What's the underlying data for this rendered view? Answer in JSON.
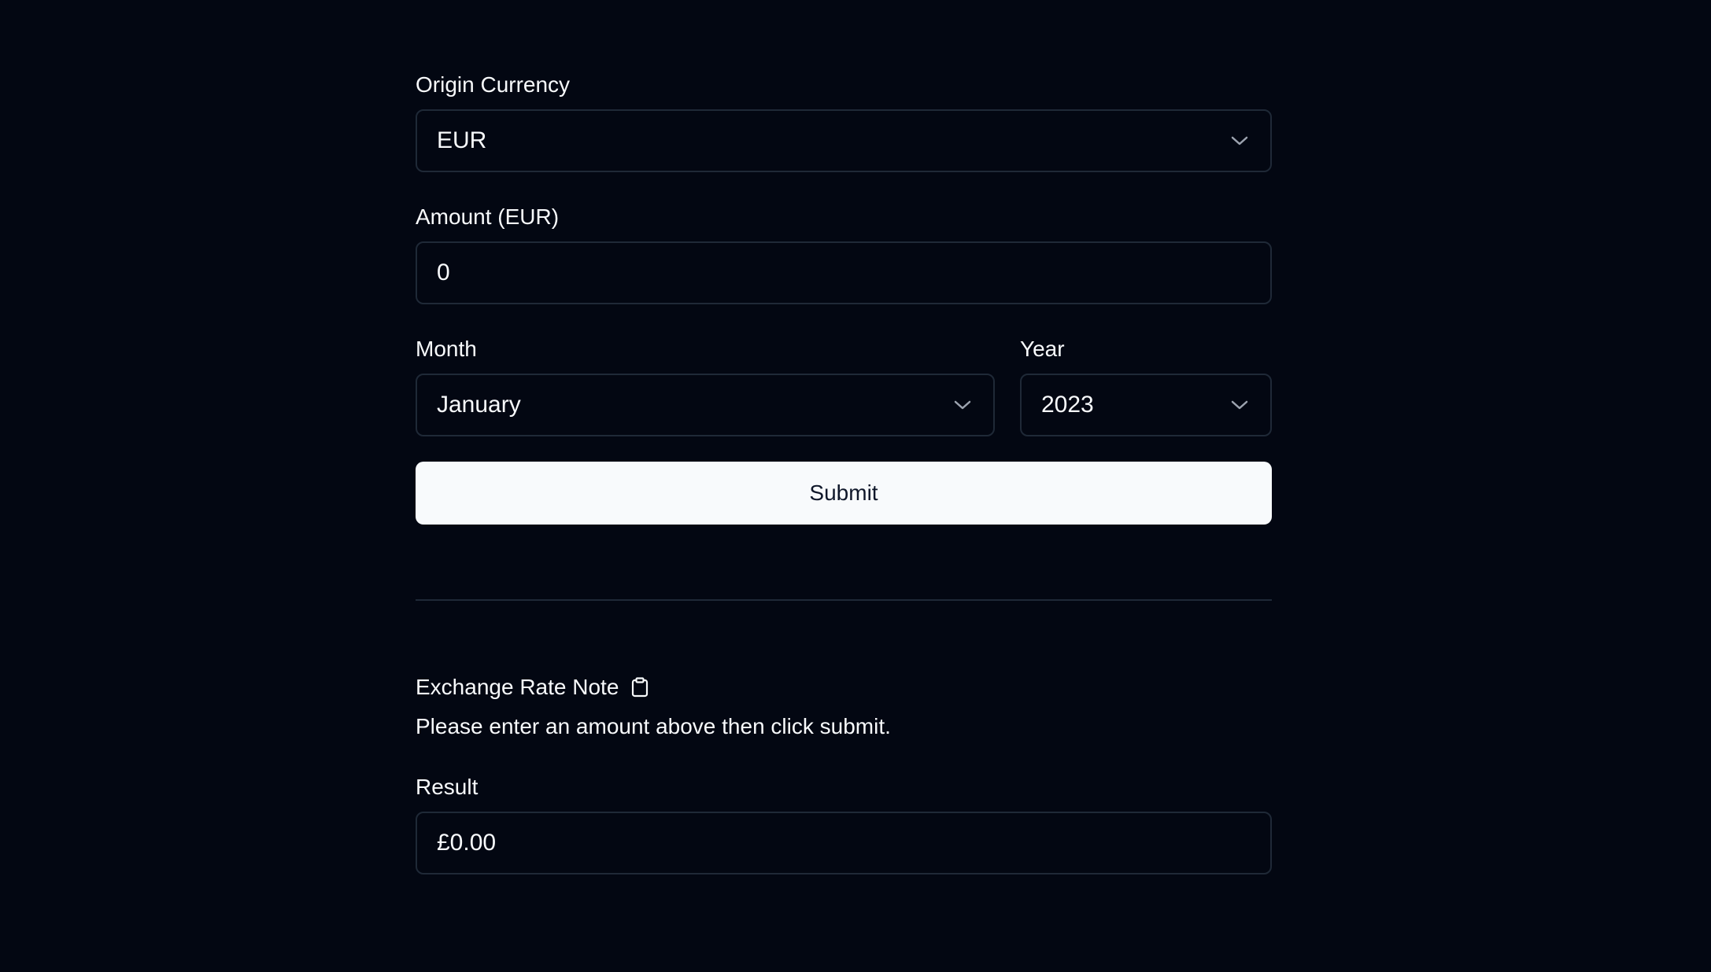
{
  "origin_currency": {
    "label": "Origin Currency",
    "selected": "EUR"
  },
  "amount": {
    "label": "Amount (EUR)",
    "value": "0"
  },
  "month": {
    "label": "Month",
    "selected": "January"
  },
  "year": {
    "label": "Year",
    "selected": "2023"
  },
  "submit_label": "Submit",
  "exchange_note": {
    "title": "Exchange Rate Note",
    "icon": "clipboard-icon",
    "text": "Please enter an amount above then click submit."
  },
  "result": {
    "label": "Result",
    "value": "£0.00"
  }
}
